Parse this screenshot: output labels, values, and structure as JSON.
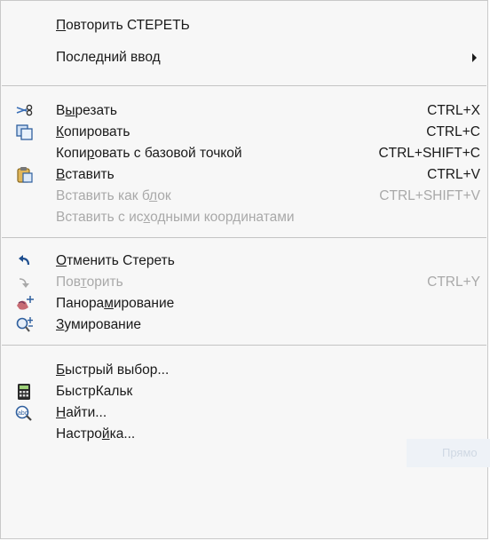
{
  "menu": {
    "repeat_erase": {
      "pre": "",
      "u": "П",
      "post": "овторить СТЕРЕТЬ"
    },
    "last_input": {
      "pre": "",
      "u": "",
      "post": "Последний ввод"
    },
    "cut": {
      "pre": "В",
      "u": "ы",
      "post": "резать",
      "shortcut": "CTRL+X",
      "icon": "scissors-icon"
    },
    "copy": {
      "pre": "",
      "u": "К",
      "post": "опировать",
      "shortcut": "CTRL+C",
      "icon": "copy-icon"
    },
    "copy_base": {
      "pre": "Копи",
      "u": "р",
      "post": "овать с базовой точкой",
      "shortcut": "CTRL+SHIFT+C"
    },
    "paste": {
      "pre": "",
      "u": "В",
      "post": "ставить",
      "shortcut": "CTRL+V",
      "icon": "paste-icon"
    },
    "paste_block": {
      "pre": "Вставить как б",
      "u": "л",
      "post": "ок",
      "shortcut": "CTRL+SHIFT+V"
    },
    "paste_orig": {
      "pre": "Вставить с ис",
      "u": "х",
      "post": "одными координатами"
    },
    "undo": {
      "pre": "",
      "u": "О",
      "post": "тменить Стереть",
      "icon": "undo-icon"
    },
    "redo": {
      "pre": "Пов",
      "u": "т",
      "post": "орить",
      "shortcut": "CTRL+Y",
      "icon": "redo-icon"
    },
    "pan": {
      "pre": "Панора",
      "u": "м",
      "post": "ирование",
      "icon": "pan-icon"
    },
    "zoom": {
      "pre": "",
      "u": "З",
      "post": "умирование",
      "icon": "zoom-icon"
    },
    "quick_select": {
      "pre": "",
      "u": "Б",
      "post": "ыстрый выбор..."
    },
    "quickcalc": {
      "pre": "",
      "u": "",
      "post": "БыстрКальк",
      "icon": "calculator-icon"
    },
    "find": {
      "pre": "",
      "u": "Н",
      "post": "айти...",
      "icon": "find-text-icon"
    },
    "options": {
      "pre": "Настро",
      "u": "й",
      "post": "ка..."
    }
  },
  "ghost_text": "Прямо"
}
